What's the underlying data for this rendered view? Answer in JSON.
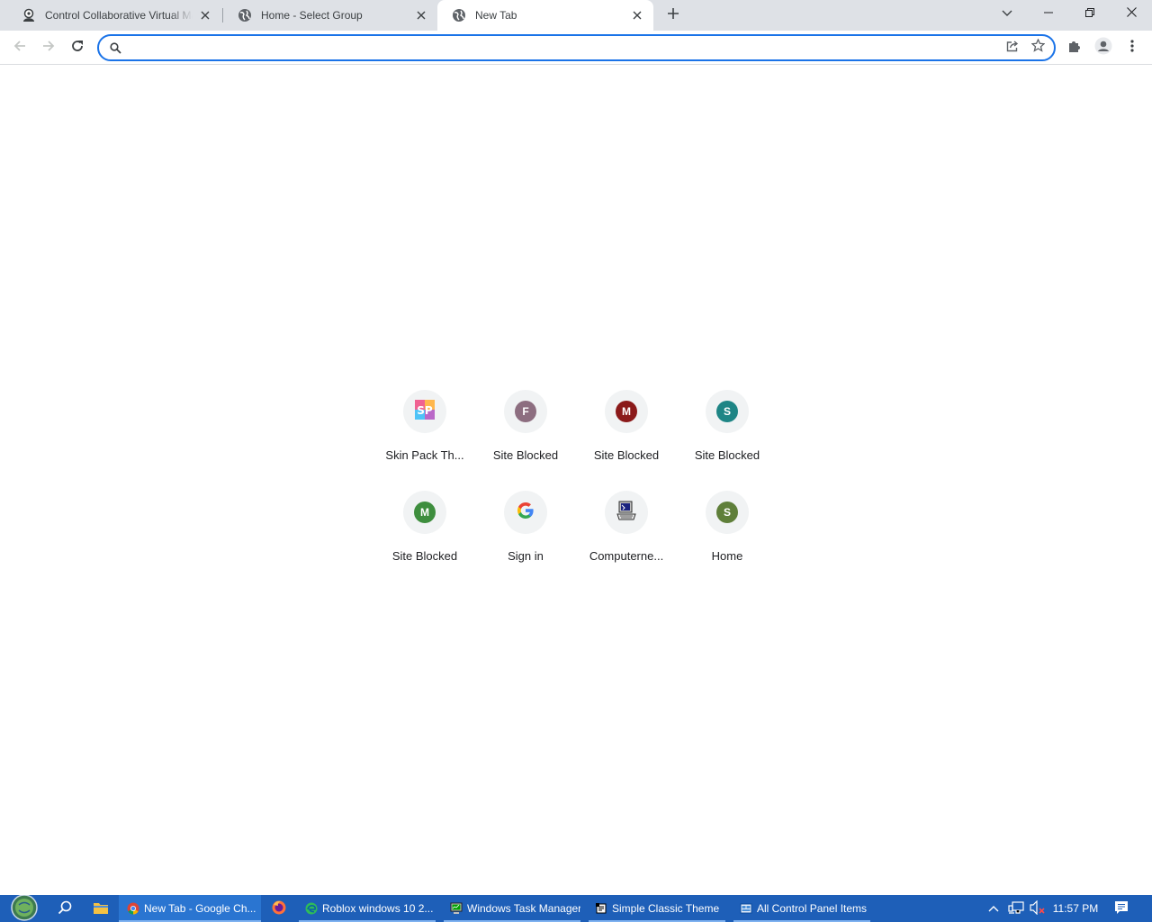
{
  "browser": {
    "tabs": [
      {
        "title": "Control Collaborative Virtual Machine",
        "favicon": "collab-vm-icon",
        "active": false
      },
      {
        "title": "Home - Select Group",
        "favicon": "globe-icon",
        "active": false
      },
      {
        "title": "New Tab",
        "favicon": "globe-icon",
        "active": true
      }
    ],
    "omnibox": {
      "value": "",
      "placeholder": ""
    },
    "accent_color": "#1a73e8"
  },
  "shortcuts": [
    {
      "label": "Skin Pack Th...",
      "icon": "skinpack-logo",
      "letter": "SP"
    },
    {
      "label": "Site Blocked",
      "icon": "letter-avatar",
      "letter": "F",
      "color": "#8d6e80"
    },
    {
      "label": "Site Blocked",
      "icon": "letter-avatar",
      "letter": "M",
      "color": "#8b1a1a"
    },
    {
      "label": "Site Blocked",
      "icon": "letter-avatar",
      "letter": "S",
      "color": "#1e8585"
    },
    {
      "label": "Site Blocked",
      "icon": "letter-avatar",
      "letter": "M",
      "color": "#3e8e3e"
    },
    {
      "label": "Sign in",
      "icon": "google-g-icon",
      "letter": "G"
    },
    {
      "label": "Computerne...",
      "icon": "computer-icon",
      "letter": ""
    },
    {
      "label": "Home",
      "icon": "letter-avatar",
      "letter": "S",
      "color": "#5f7f3a"
    }
  ],
  "taskbar": {
    "items": [
      {
        "label": "New Tab - Google Ch...",
        "icon": "chrome-icon",
        "active": true
      },
      {
        "label": "Roblox windows 10 2...",
        "icon": "edge-icon",
        "active": false
      },
      {
        "label": "Windows Task Manager",
        "icon": "task-manager-icon",
        "active": false
      },
      {
        "label": "Simple Classic Theme",
        "icon": "theme-icon",
        "active": false
      },
      {
        "label": "All Control Panel Items",
        "icon": "control-panel-icon",
        "active": false
      }
    ],
    "clock": "11:57 PM",
    "color": "#1e5fb8"
  }
}
